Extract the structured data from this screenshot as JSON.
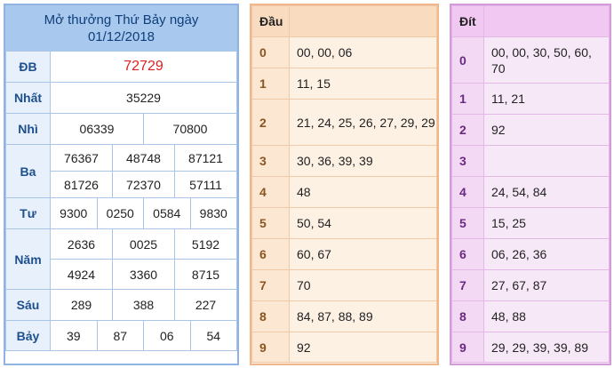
{
  "result": {
    "header_line1": "Mở thưởng Thứ Bảy ngày",
    "header_line2": "01/12/2018",
    "prizes": {
      "db": {
        "label": "ĐB",
        "values": [
          "72729"
        ]
      },
      "nhat": {
        "label": "Nhất",
        "values": [
          "35229"
        ]
      },
      "nhi": {
        "label": "Nhì",
        "values": [
          "06339",
          "70800"
        ]
      },
      "ba": {
        "label": "Ba",
        "values": [
          "76367",
          "48748",
          "87121",
          "81726",
          "72370",
          "57111"
        ]
      },
      "tu": {
        "label": "Tư",
        "values": [
          "9300",
          "0250",
          "0584",
          "9830"
        ]
      },
      "nam": {
        "label": "Năm",
        "values": [
          "2636",
          "0025",
          "5192",
          "4924",
          "3360",
          "8715"
        ]
      },
      "sau": {
        "label": "Sáu",
        "values": [
          "289",
          "388",
          "227"
        ]
      },
      "bay": {
        "label": "Bảy",
        "values": [
          "39",
          "87",
          "06",
          "54"
        ]
      }
    }
  },
  "dau": {
    "header": "Đầu",
    "rows": [
      {
        "key": "0",
        "values": "00, 00, 06"
      },
      {
        "key": "1",
        "values": "11, 15"
      },
      {
        "key": "2",
        "values": "21, 24, 25, 26, 27, 29, 29"
      },
      {
        "key": "3",
        "values": "30, 36, 39, 39"
      },
      {
        "key": "4",
        "values": "48"
      },
      {
        "key": "5",
        "values": "50, 54"
      },
      {
        "key": "6",
        "values": "60, 67"
      },
      {
        "key": "7",
        "values": "70"
      },
      {
        "key": "8",
        "values": "84, 87, 88, 89"
      },
      {
        "key": "9",
        "values": "92"
      }
    ]
  },
  "dit": {
    "header": "Đít",
    "rows": [
      {
        "key": "0",
        "values": "00, 00, 30, 50, 60, 70"
      },
      {
        "key": "1",
        "values": "11, 21"
      },
      {
        "key": "2",
        "values": "92"
      },
      {
        "key": "3",
        "values": ""
      },
      {
        "key": "4",
        "values": "24, 54, 84"
      },
      {
        "key": "5",
        "values": "15, 25"
      },
      {
        "key": "6",
        "values": "06, 26, 36"
      },
      {
        "key": "7",
        "values": "27, 67, 87"
      },
      {
        "key": "8",
        "values": "48, 88"
      },
      {
        "key": "9",
        "values": "29, 29, 39, 39, 89"
      }
    ]
  }
}
